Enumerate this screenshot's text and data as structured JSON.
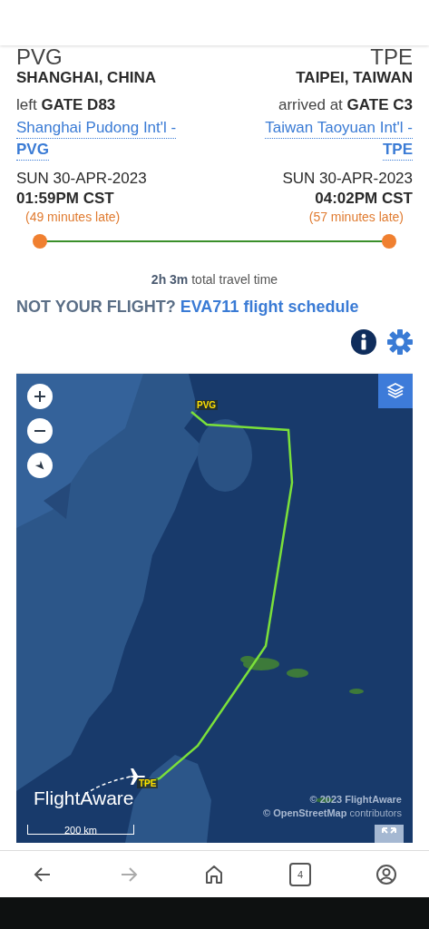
{
  "origin": {
    "code": "PVG",
    "city": "SHANGHAI, CHINA",
    "gate_prefix": "left",
    "gate": "GATE D83",
    "airport_link": "Shanghai Pudong Int'l -",
    "airport_code": "PVG",
    "date": "SUN 30-APR-2023",
    "time": "01:59PM CST",
    "delay": "(49 minutes late)"
  },
  "destination": {
    "code": "TPE",
    "city": "TAIPEI, TAIWAN",
    "gate_prefix": "arrived at",
    "gate": "GATE C3",
    "airport_link": "Taiwan Taoyuan Int'l -",
    "airport_code": "TPE",
    "date": "SUN 30-APR-2023",
    "time": "04:02PM CST",
    "delay": "(57 minutes late)"
  },
  "progress": {
    "level": 1
  },
  "travel_time": "**2h 3m** total travel time",
  "not_your_flight": {
    "question": "NOT YOUR FLIGHT?",
    "link": "EVA711 flight schedule"
  },
  "map": {
    "kind": "picture",
    "origin_label": "PVG",
    "destination_label": "TPE",
    "logo": "FlightAware",
    "copyright": "© 2023 FlightAware",
    "osm_link": "© OpenStreetMap",
    "osm_suffix": "contributors",
    "scale": "200 km"
  },
  "nav": [
    {
      "kind": "back",
      "disabled": false
    },
    {
      "kind": "forward",
      "disabled": true
    },
    {
      "kind": "home",
      "disabled": false
    },
    {
      "kind": "tabs",
      "disabled": false,
      "count": "4"
    },
    {
      "kind": "account",
      "disabled": false
    }
  ]
}
